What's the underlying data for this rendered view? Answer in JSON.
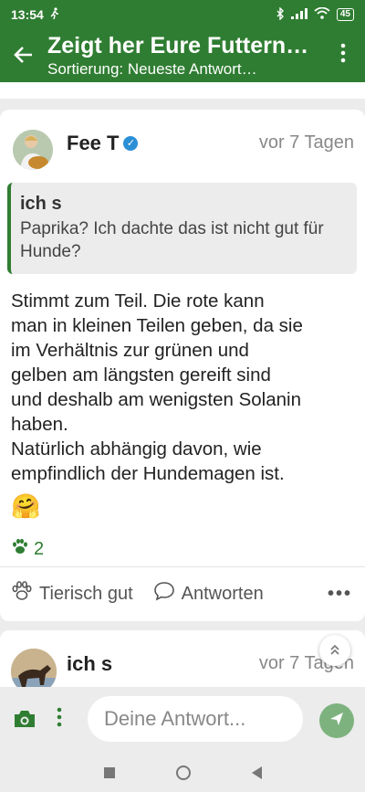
{
  "status": {
    "time": "13:54",
    "battery": "45"
  },
  "appbar": {
    "title": "Zeigt her Eure Futtern…",
    "subtitle": "Sortierung: Neueste Antwort…"
  },
  "post": {
    "author": "Fee T",
    "date": "vor 7 Tagen",
    "quote": {
      "author": "ich s",
      "text": "Paprika? Ich dachte das ist nicht gut für Hunde?"
    },
    "body_lines": [
      "Stimmt zum Teil. Die rote kann",
      "man in kleinen Teilen geben, da sie",
      "im Verhältnis zur grünen und",
      "gelben am längsten gereift sind",
      "und deshalb am wenigsten Solanin",
      "haben.",
      "Natürlich abhängig davon, wie",
      "empfindlich der Hundemagen ist."
    ],
    "emoji": "🤗",
    "paw_count": "2",
    "actions": {
      "like": "Tierisch gut",
      "reply": "Antworten"
    }
  },
  "next_post": {
    "author": "ich s",
    "date": "vor 7 Tagen"
  },
  "composer": {
    "placeholder": "Deine Antwort..."
  },
  "colors": {
    "primary": "#2f7d32",
    "send": "#7db27f",
    "verified": "#2b8fd6"
  }
}
